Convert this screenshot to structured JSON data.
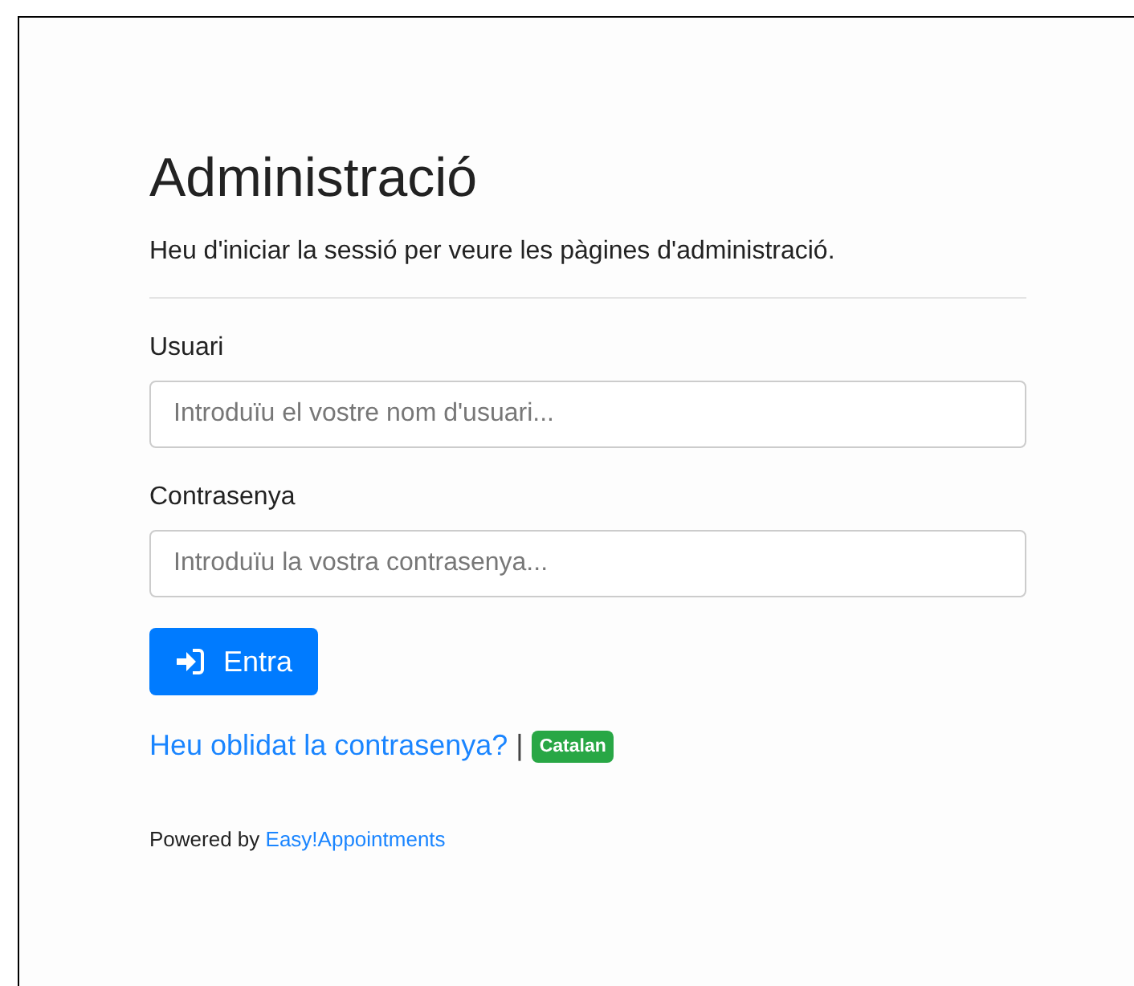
{
  "title": "Administració",
  "subtitle": "Heu d'iniciar la sessió per veure les pàgines d'administració.",
  "fields": [
    {
      "label": "Usuari",
      "placeholder": "Introduïu el vostre nom d'usuari..."
    },
    {
      "label": "Contrasenya",
      "placeholder": "Introduïu la vostra contrasenya..."
    }
  ],
  "submit_button": "Entra",
  "forgot_link": "Heu oblidat la contrasenya?",
  "separator": "|",
  "language_badge": "Catalan",
  "footer": {
    "prefix": "Powered by",
    "link": "Easy!Appointments"
  }
}
